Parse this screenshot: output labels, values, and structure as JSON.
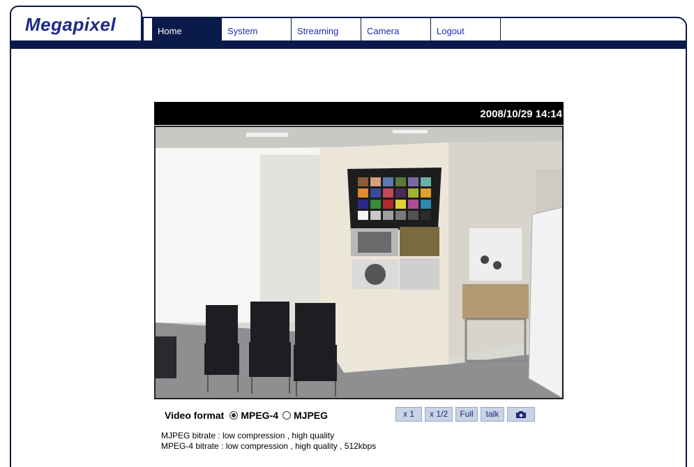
{
  "brand": {
    "logo": "Megapixel"
  },
  "nav": {
    "items": [
      {
        "label": "Home"
      },
      {
        "label": "System"
      },
      {
        "label": "Streaming"
      },
      {
        "label": "Camera"
      },
      {
        "label": "Logout"
      }
    ],
    "active": "Home"
  },
  "video": {
    "timestamp": "2008/10/29 14:14"
  },
  "controls": {
    "video_format_label": "Video format",
    "formats": [
      {
        "label": "MPEG-4",
        "selected": true
      },
      {
        "label": "MJPEG",
        "selected": false
      }
    ],
    "buttons": {
      "zoom_1": "x 1",
      "zoom_half": "x 1/2",
      "full": "Full",
      "talk": "talk",
      "snapshot_icon": "camera-icon"
    }
  },
  "info": {
    "mjpeg_bitrate": "MJPEG bitrate : low compression , high quality",
    "mpeg4_bitrate": "MPEG-4 bitrate : low compression , high quality , 512kbps"
  },
  "colors": {
    "header_navy": "#0a1a4a",
    "logo_blue": "#1d2a8a",
    "nav_link": "#1b2fb0",
    "button_bg": "#c9d3e6"
  }
}
